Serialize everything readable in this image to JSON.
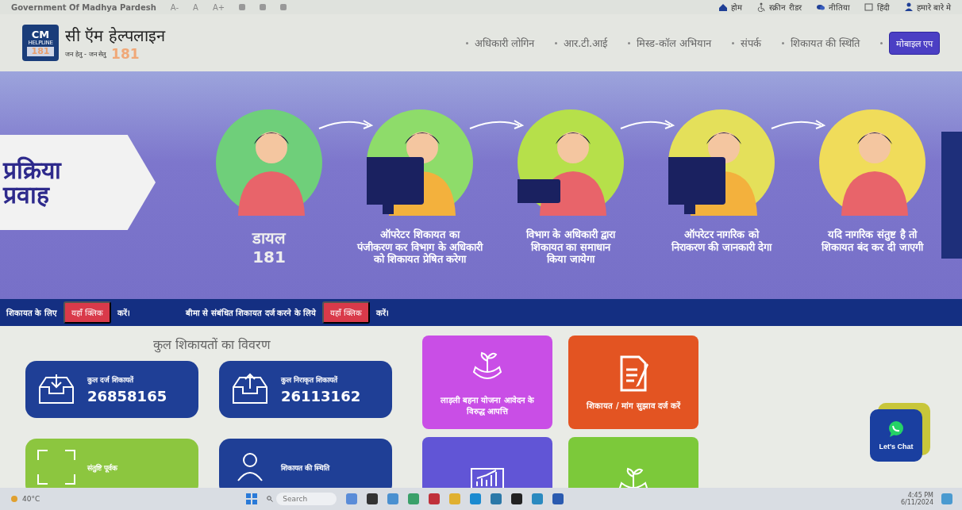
{
  "top_bar": {
    "site_name": "Government Of Madhya Pardesh",
    "font_controls": [
      "A-",
      "A",
      "A+"
    ],
    "links": [
      "होम",
      "स्क्रीन रीडर",
      "नीतिया",
      "हिंदी",
      "हमारे बारे मे"
    ]
  },
  "header": {
    "logo_badge": {
      "line_1": "CM",
      "line_2": "HELPLINE",
      "line_3": "181"
    },
    "title": "सी ऍम हेल्पलाइन",
    "tagline": "जन हेतु - जन सेतु",
    "tagline_number": "181"
  },
  "nav": [
    {
      "label": "अधिकारी लोगिन",
      "kind": "link"
    },
    {
      "label": "आर.टी.आई",
      "kind": "link"
    },
    {
      "label": "मिस्ड-कॉल अभियान",
      "kind": "link"
    },
    {
      "label": "संपर्क",
      "kind": "link"
    },
    {
      "label": "शिकायत की स्थिति",
      "kind": "link"
    },
    {
      "label": "मोबाइल एप",
      "kind": "button"
    }
  ],
  "hero": {
    "title_lines": [
      "प्रक्रिया",
      "प्रवाह"
    ],
    "steps": [
      {
        "caption_lines": [
          "डायल",
          "181"
        ],
        "color": "#6fcf7a"
      },
      {
        "caption_lines": [
          "ऑपरेटर शिकायत का",
          "पंजीकरण कर विभाग के अधिकारी",
          "को शिकायत प्रेषित करेगा"
        ],
        "color": "#8edc6a"
      },
      {
        "caption_lines": [
          "विभाग के अधिकारी द्वारा",
          "शिकायत का समाधान",
          "किया जायेगा"
        ],
        "color": "#b6e04a"
      },
      {
        "caption_lines": [
          "ऑपरेटर नागरिक को",
          "निराकरण की जानकारी देगा"
        ],
        "color": "#e4e05a"
      },
      {
        "caption_lines": [
          "यदि नागरिक संतुष्ट है तो",
          "शिकायत बंद कर दी जाएगी"
        ],
        "color": "#f0dc5a"
      }
    ]
  },
  "banner": {
    "segments": [
      {
        "text": "शिकायत के लिए",
        "link": "यहाँ क्लिक",
        "suffix": "करें।"
      },
      {
        "text": "बीमा से संबंधित शिकायत दर्ज करने के लिये",
        "link": "यहाँ क्लिक",
        "suffix": "करें।"
      }
    ]
  },
  "stats": {
    "title": "कुल शिकायतों का विवरण",
    "cards": [
      {
        "label": "कुल दर्ज शिकायतें",
        "value": "26858165",
        "color": "#1f3f96"
      },
      {
        "label": "कुल निराकृत शिकायतें",
        "value": "26113162",
        "color": "#1f3f96"
      },
      {
        "label": "संतुष्टि पूर्वक",
        "color": "#8cc63f"
      },
      {
        "label": "शिकायत की स्थिति",
        "color": "#1f3f96"
      }
    ]
  },
  "tiles": [
    {
      "label": "लाड़ली बहना योजना आवेदन के विरुद्ध आपत्ति",
      "color": "#c94ee6"
    },
    {
      "label": "शिकायत / मांग सुझाव दर्ज करें",
      "color": "#e35422"
    },
    {
      "color": "#6155d6"
    },
    {
      "color": "#7cc93a"
    }
  ],
  "chat": {
    "label": "Let's Chat"
  },
  "taskbar": {
    "weather": "40°C",
    "search_placeholder": "Search",
    "time": "4:45 PM",
    "date": "6/11/2024"
  }
}
